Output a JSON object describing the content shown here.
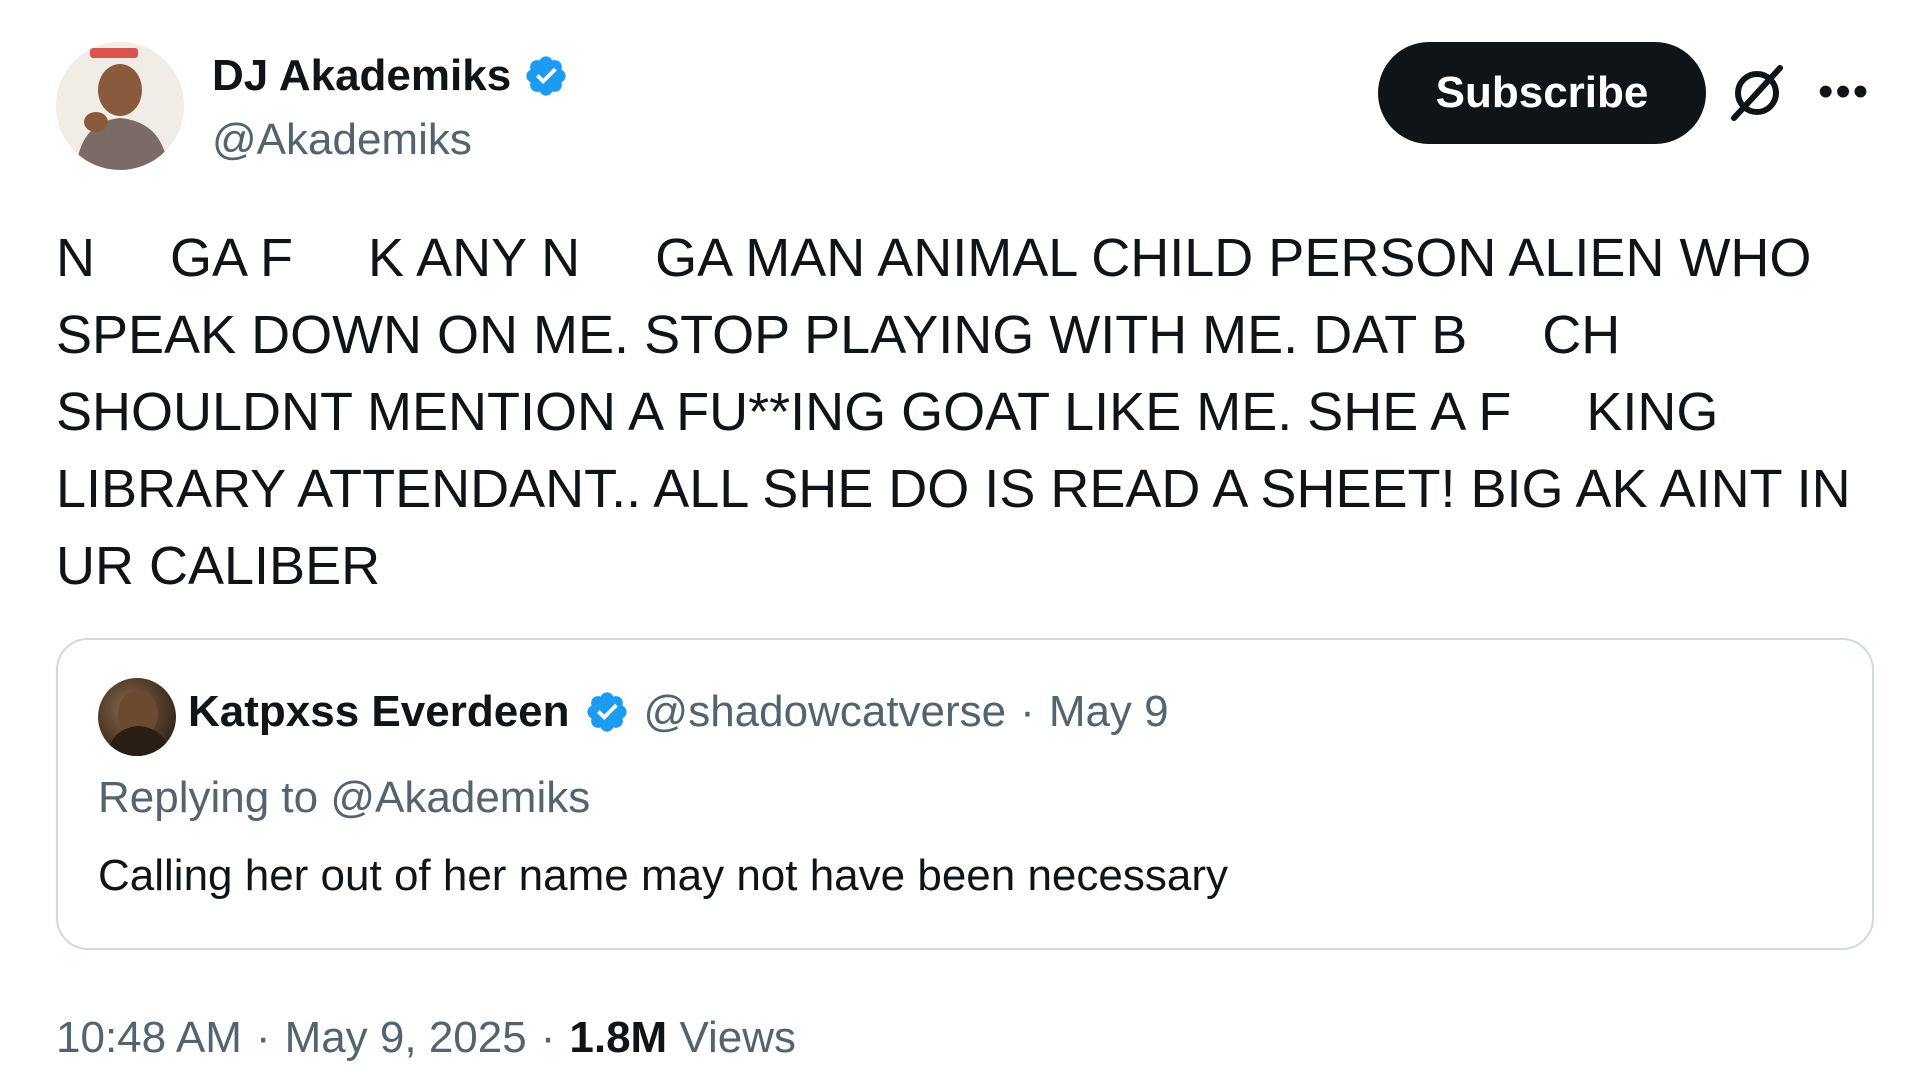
{
  "author": {
    "name": "DJ Akademiks",
    "handle": "@Akademiks",
    "verified": true,
    "badge_color": "#1d9bf0"
  },
  "actions": {
    "subscribe_label": "Subscribe",
    "grok_icon": "grok-icon",
    "more_icon": "more-icon"
  },
  "tweet": {
    "text": "N     GA F     K ANY N     GA MAN ANIMAL CHILD PERSON ALIEN WHO SPEAK DOWN ON ME. STOP PLAYING WITH ME. DAT B     CH SHOULDNT MENTION A FU**ING GOAT LIKE ME. SHE A F     KING LIBRARY ATTENDANT.. ALL SHE DO IS READ A SHEET! BIG AK AINT IN UR CALIBER"
  },
  "quoted_tweet": {
    "name": "Katpxss Everdeen",
    "handle": "@shadowcatverse",
    "separator": "·",
    "date": "May 9",
    "replying_prefix": "Replying to",
    "replying_to": "@Akademiks",
    "text": "Calling her out of her name may not have been necessary"
  },
  "meta": {
    "time": "10:48 AM",
    "separator": "·",
    "date": "May 9, 2025",
    "views_count": "1.8M",
    "views_label": "Views"
  },
  "colors": {
    "text_primary": "#0f1419",
    "text_secondary": "#536471",
    "border": "#cfd9de",
    "button_bg": "#0f1419"
  }
}
